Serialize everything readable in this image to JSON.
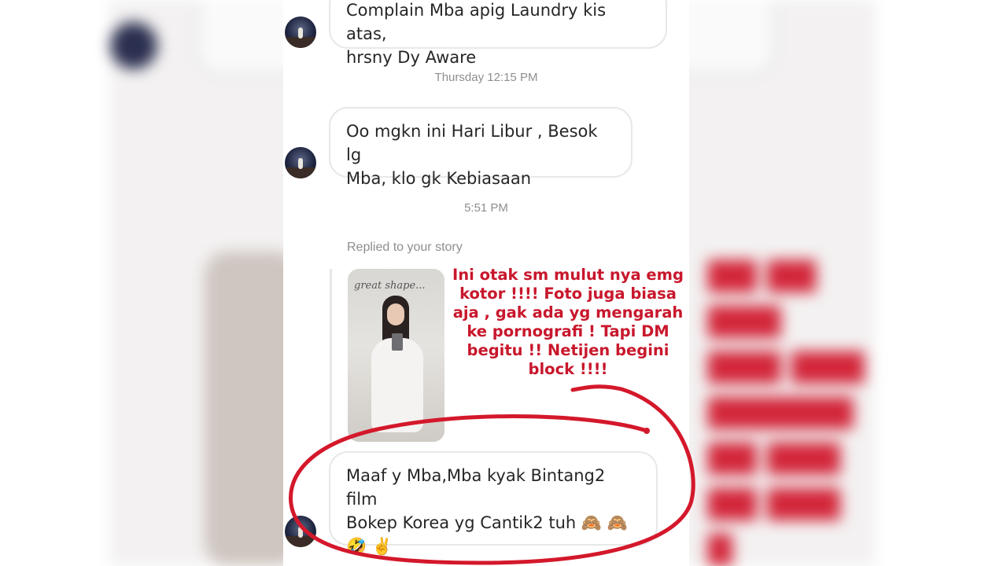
{
  "conversation": {
    "messages": [
      {
        "text_line1": "Complain Mba apig Laundry kis atas,",
        "text_line2": "hrsny Dy Aware"
      },
      {
        "text_line1": "Oo mgkn ini Hari Libur , Besok lg",
        "text_line2": "Mba, klo gk Kebiasaan"
      },
      {
        "text_line1": "Maaf y Mba,Mba kyak Bintang2 film",
        "text_line2": "Bokep Korea yg Cantik2 tuh 🙈 🙈",
        "text_line3": "🤣 ✌️"
      }
    ],
    "timestamps": [
      "Thursday 12:15 PM",
      "5:51 PM"
    ],
    "replied_label": "Replied to your story",
    "story_scribble": "great shape..."
  },
  "annotation": {
    "lines": [
      "Ini otak sm mulut nya emg",
      "kotor !!!! Foto juga biasa",
      "aja , gak ada yg mengarah",
      "ke pornografi ! Tapi DM",
      "begitu !! Netijen begini",
      "block !!!!"
    ],
    "color": "#c8172c"
  }
}
